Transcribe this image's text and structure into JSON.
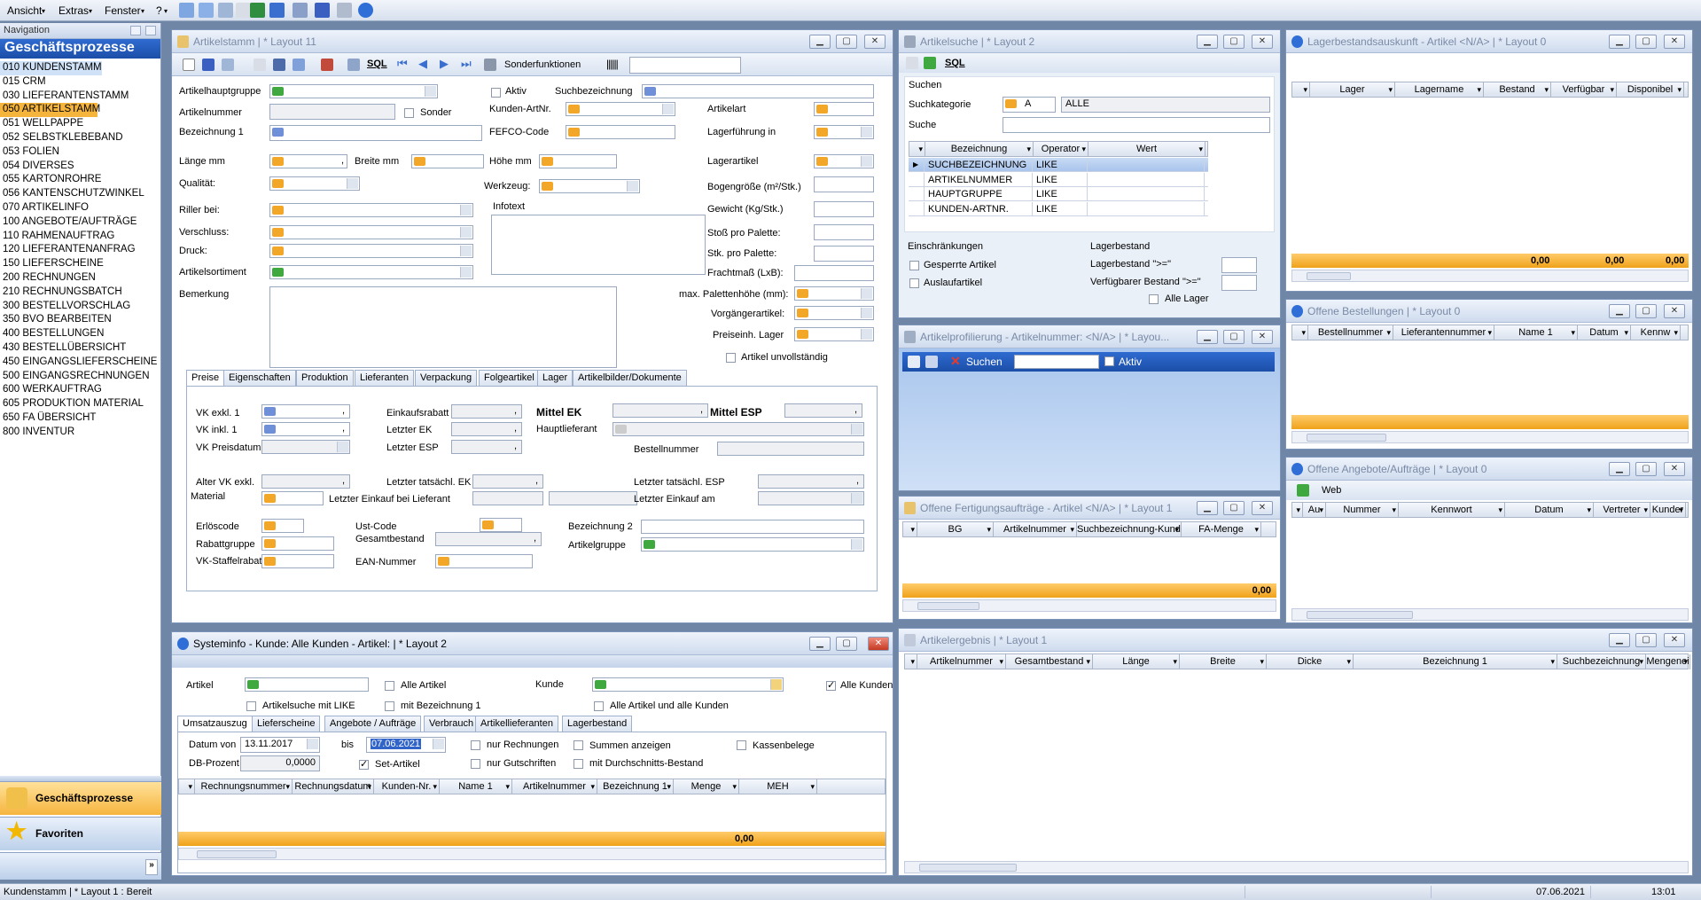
{
  "menubar": {
    "items": [
      "Ansicht",
      "Extras",
      "Fenster",
      "?"
    ]
  },
  "nav": {
    "header": "Navigation",
    "title": "Geschäftsprozesse",
    "items": [
      "010 KUNDENSTAMM",
      "015 CRM",
      "030 LIEFERANTENSTAMM",
      "050 ARTIKELSTAMM",
      "051 WELLPAPPE",
      "052 SELBSTKLEBEBAND",
      "053 FOLIEN",
      "054 DIVERSES",
      "055 KARTONROHRE",
      "056 KANTENSCHUTZWINKEL",
      "070 ARTIKELINFO",
      "100 ANGEBOTE/AUFTRÄGE",
      "110 RAHMENAUFTRAG",
      "120 LIEFERANTENANFRAG",
      "150 LIEFERSCHEINE",
      "200 RECHNUNGEN",
      "210 RECHNUNGSBATCH",
      "300 BESTELLVORSCHLAG",
      "350 BVO BEARBEITEN",
      "400 BESTELLUNGEN",
      "430 BESTELLÜBERSICHT",
      "450 EINGANGSLIEFERSCHEINE",
      "500 EINGANGSRECHNUNGEN",
      "600 WERKAUFTRAG",
      "605 PRODUKTION MATERIAL",
      "650 FA ÜBERSICHT",
      "800 INVENTUR"
    ],
    "btn_processes": "Geschäftsprozesse",
    "btn_favorites": "Favoriten"
  },
  "artikelstamm": {
    "title": "Artikelstamm | * Layout 11",
    "toolbar": {
      "sql": "SQL",
      "sonder": "Sonderfunktionen"
    },
    "labels": {
      "hauptgruppe": "Artikelhauptgruppe",
      "aktiv": "Aktiv",
      "suchbez": "Suchbezeichnung",
      "artikelnummer": "Artikelnummer",
      "sonder": "Sonder",
      "kundenartnr": "Kunden-ArtNr.",
      "artikelart": "Artikelart",
      "bezeichnung1": "Bezeichnung 1",
      "fefco": "FEFCO-Code",
      "lagerfuehrung": "Lagerführung in",
      "laenge": "Länge mm",
      "breite": "Breite mm",
      "hoehe": "Höhe mm",
      "lagerartikel": "Lagerartikel",
      "qualitaet": "Qualität:",
      "werkzeug": "Werkzeug:",
      "bogen": "Bogengröße (m²/Stk.)",
      "riller": "Riller bei:",
      "infotext": "Infotext",
      "gewicht": "Gewicht (Kg/Stk.)",
      "verschluss": "Verschluss:",
      "stoss": "Stoß pro Palette:",
      "druck": "Druck:",
      "stk": "Stk. pro Palette:",
      "sortiment": "Artikelsortiment",
      "fracht": "Frachtmaß (LxB):",
      "bemerkung": "Bemerkung",
      "maxpal": "max. Palettenhöhe (mm):",
      "vorgaenger": "Vorgängerartikel:",
      "preiseinh": "Preiseinh. Lager",
      "unvollst": "Artikel unvollständig"
    },
    "tabs": [
      "Preise",
      "Eigenschaften",
      "Produktion",
      "Lieferanten",
      "Verpackung",
      "Folgeartikel",
      "Lager",
      "Artikelbilder/Dokumente"
    ],
    "preise": {
      "vkexkl": "VK exkl. 1",
      "vkinkl": "VK inkl. 1",
      "vkdatum": "VK Preisdatum",
      "einkaufsrabatt": "Einkaufsrabatt",
      "letzterek": "Letzter EK",
      "letzteresp": "Letzter ESP",
      "mittelek": "Mittel EK",
      "mittelesp": "Mittel ESP",
      "hauptlieferant": "Hauptlieferant",
      "bestellnummer": "Bestellnummer",
      "altervk": "Alter VK exkl.",
      "letzterteek": "Letzter tatsächl. EK",
      "letzterteesp": "Letzter tatsächl. ESP",
      "material": "Material",
      "letzterlief": "Letzter Einkauf bei Lieferant",
      "letzteram": "Letzter Einkauf am",
      "erloes": "Erlöscode",
      "ustcode": "Ust-Code",
      "bez2": "Bezeichnung 2",
      "rabattgruppe": "Rabattgruppe",
      "gesamtbestand": "Gesamtbestand",
      "artikelgruppe": "Artikelgruppe",
      "vkstaffel": "VK-Staffelrabatt",
      "ean": "EAN-Nummer",
      "comma": ","
    }
  },
  "systeminfo": {
    "title": "Systeminfo  -  Kunde: Alle Kunden - Artikel:  | * Layout 2",
    "artikel": "Artikel",
    "alleartikel": "Alle Artikel",
    "kunde": "Kunde",
    "allekunden": "Alle Kunden",
    "like": "Artikelsuche mit LIKE",
    "mitbez": "mit Bezeichnung 1",
    "alleartkunden": "Alle Artikel und alle Kunden",
    "tabs": [
      "Umsatzauszug",
      "Lieferscheine",
      "Angebote / Aufträge",
      "Verbrauch",
      "Artikellieferanten",
      "Lagerbestand"
    ],
    "datumvon": "Datum von",
    "datevon": "13.11.2017",
    "bis": "bis",
    "datebis": "07.06.2021",
    "nurrech": "nur Rechnungen",
    "summen": "Summen anzeigen",
    "kassen": "Kassenbelege",
    "dbprozent": "DB-Prozent",
    "dbval": "0,0000",
    "setartikel": "Set-Artikel",
    "nurgut": "nur Gutschriften",
    "durchschnitt": "mit Durchschnitts-Bestand",
    "columns": [
      "Rechnungsnummer",
      "Rechnungsdatum",
      "Kunden-Nr.",
      "Name 1",
      "Artikelnummer",
      "Bezeichnung 1",
      "Menge",
      "MEH"
    ],
    "sum": "0,00"
  },
  "artikelsuche": {
    "title": "Artikelsuche | * Layout 2",
    "suchen": "Suchen",
    "suchkategorie": "Suchkategorie",
    "kat": "A",
    "alle": "ALLE",
    "suche": "Suche",
    "columns": [
      "Bezeichnung",
      "Operator",
      "Wert"
    ],
    "rows": [
      {
        "bez": "SUCHBEZEICHNUNG",
        "op": "LIKE"
      },
      {
        "bez": "ARTIKELNUMMER",
        "op": "LIKE"
      },
      {
        "bez": "HAUPTGRUPPE",
        "op": "LIKE"
      },
      {
        "bez": "KUNDEN-ARTNR.",
        "op": "LIKE"
      }
    ],
    "einschr": "Einschränkungen",
    "gesperrt": "Gesperrte Artikel",
    "auslauf": "Auslaufartikel",
    "lagerbestand": "Lagerbestand",
    "lbge": "Lagerbestand \">=\"",
    "vbge": "Verfügbarer Bestand \">=\"",
    "allelager": "Alle Lager"
  },
  "profilierung": {
    "title": "Artikelprofilierung  -  Artikelnummer: <N/A>  | * Layou...",
    "suchen": "Suchen",
    "aktiv": "Aktiv"
  },
  "fertigung": {
    "title": "Offene Fertigungsaufträge  -  Artikel <N/A>  | * Layout 1",
    "columns": [
      "BG",
      "Artikelnummer",
      "Suchbezeichnung-Kunde",
      "FA-Menge"
    ],
    "sum": "0,00"
  },
  "lagerbestand": {
    "title": "Lagerbestandsauskunft  -  Artikel <N/A>  | * Layout 0",
    "columns": [
      "Lager",
      "Lagername",
      "Bestand",
      "Verfügbar",
      "Disponibel"
    ],
    "sums": [
      "0,00",
      "0,00",
      "0,00"
    ]
  },
  "bestellungen": {
    "title": "Offene Bestellungen | * Layout 0",
    "columns": [
      "Bestellnummer",
      "Lieferantennummer",
      "Name 1",
      "Datum",
      "Kennw"
    ]
  },
  "angebote": {
    "title": "Offene Angebote/Aufträge | * Layout 0",
    "web": "Web",
    "columns": [
      "Au",
      "Nummer",
      "Kennwort",
      "Datum",
      "Vertreter",
      "Kunder"
    ]
  },
  "artikelergebnis": {
    "title": "Artikelergebnis | * Layout 1",
    "columns": [
      "Artikelnummer",
      "Gesamtbestand",
      "Länge",
      "Breite",
      "Dicke",
      "Bezeichnung 1",
      "Suchbezeichnung",
      "Mengenei"
    ]
  },
  "status": {
    "text": "Kundenstamm | * Layout 1 : Bereit",
    "date": "07.06.2021",
    "time": "13:01"
  }
}
